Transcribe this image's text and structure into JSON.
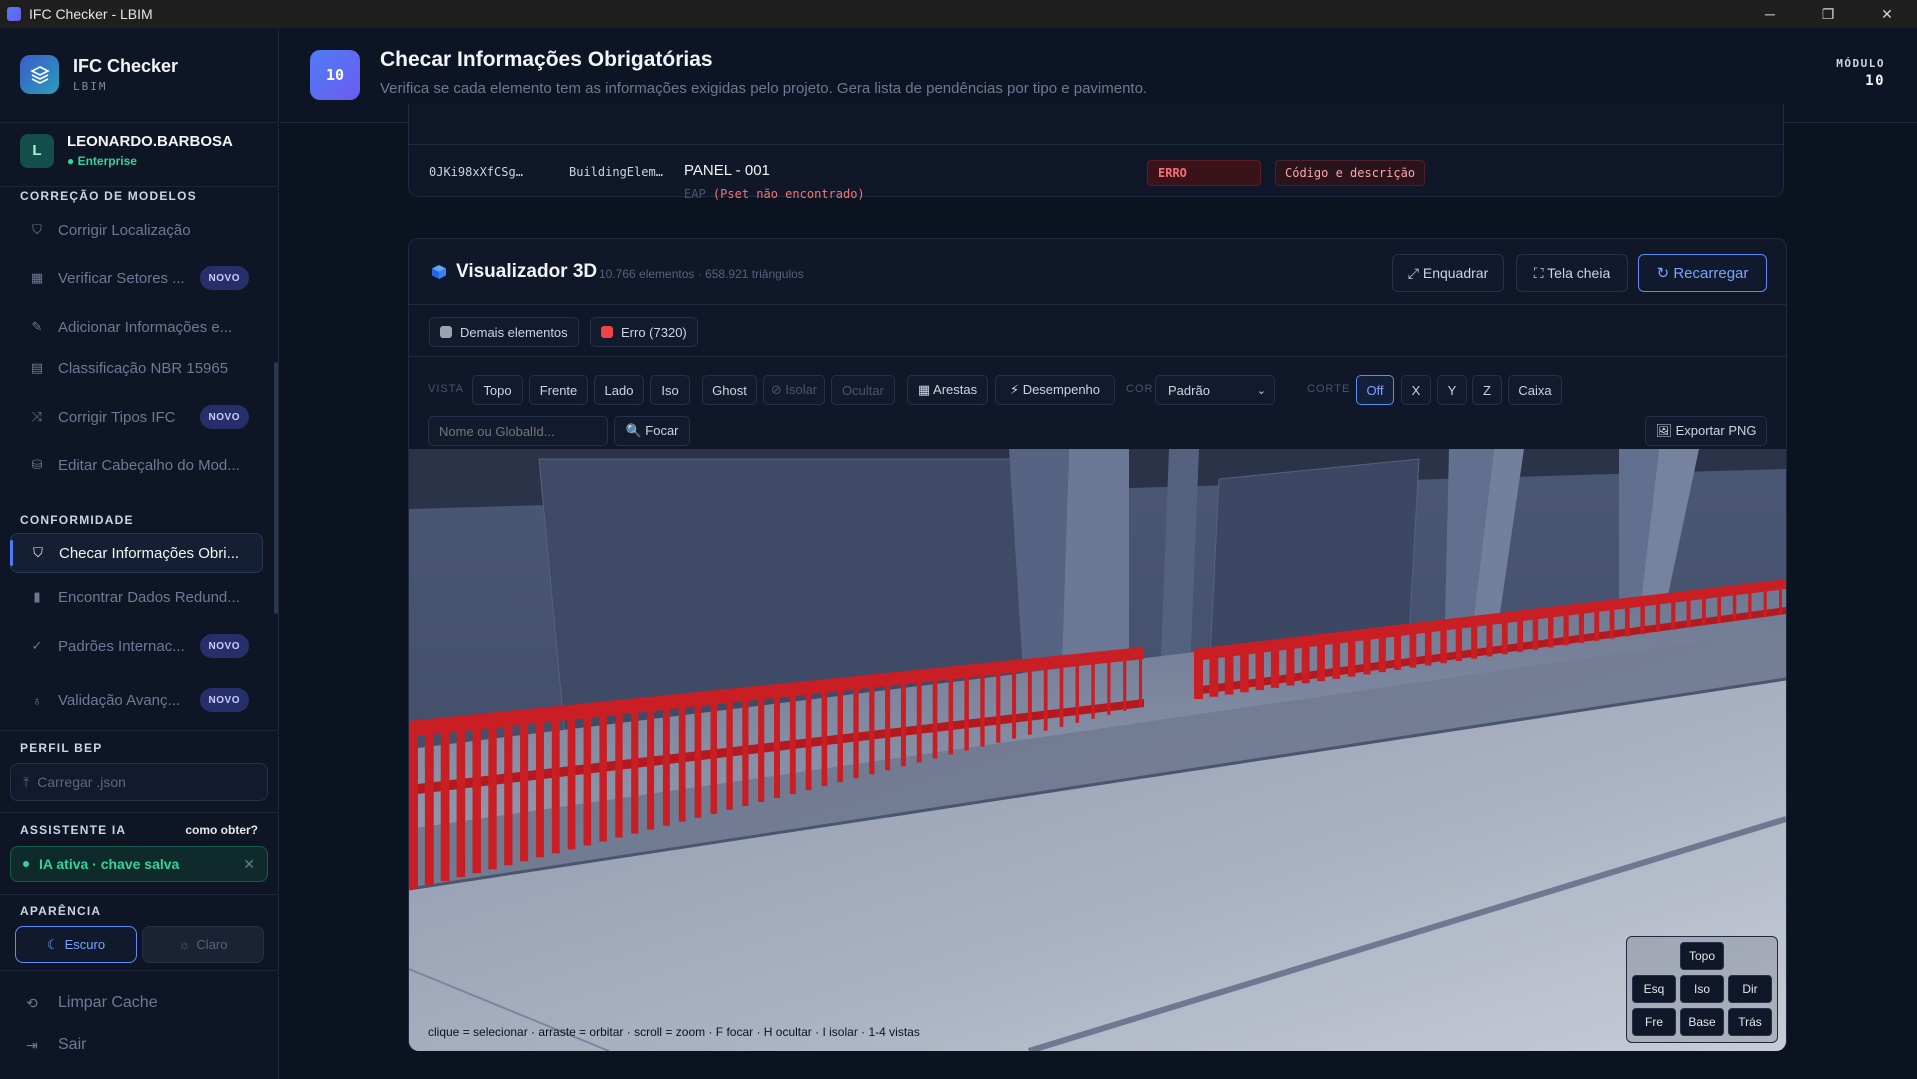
{
  "window": {
    "title": "IFC Checker - LBIM",
    "minimize": "─",
    "maximize": "❐",
    "close": "✕"
  },
  "sidebar": {
    "brand_name": "IFC Checker",
    "brand_sub": "LBIM",
    "user_initial": "L",
    "user_name": "LEONARDO.BARBOSA",
    "user_plan": "● Enterprise",
    "section_correcao": "CORREÇÃO DE MODELOS",
    "items_correcao": [
      {
        "label": "Corrigir Localização",
        "badge": ""
      },
      {
        "label": "Verificar Setores ...",
        "badge": "NOVO"
      },
      {
        "label": "Adicionar Informações e...",
        "badge": ""
      },
      {
        "label": "Classificação NBR 15965",
        "badge": ""
      },
      {
        "label": "Corrigir Tipos IFC",
        "badge": "NOVO"
      },
      {
        "label": "Editar Cabeçalho do Mod...",
        "badge": ""
      }
    ],
    "section_conformidade": "CONFORMIDADE",
    "items_conformidade": [
      {
        "label": "Checar Informações Obri...",
        "badge": ""
      },
      {
        "label": "Encontrar Dados Redund...",
        "badge": ""
      },
      {
        "label": "Padrões Internac...",
        "badge": "NOVO"
      },
      {
        "label": "Validação Avanç...",
        "badge": "NOVO"
      }
    ],
    "section_perfil": "PERFIL BEP",
    "file_input_label": "Carregar .json",
    "section_ia": "ASSISTENTE IA",
    "ia_help": "como obter?",
    "ia_status": "IA ativa · chave salva",
    "section_aparencia": "APARÊNCIA",
    "theme_dark": "Escuro",
    "theme_light": "Claro",
    "clear_cache": "Limpar Cache",
    "logout": "Sair"
  },
  "header": {
    "module_badge": "10",
    "title": "Checar Informações Obrigatórias",
    "description": "Verifica se cada elemento tem as informações exigidas pelo projeto. Gera lista de pendências por tipo e pavimento.",
    "module_label": "MÓDULO",
    "module_number": "10"
  },
  "result_row": {
    "guid": "0JKi98xXfCSg…",
    "ifc_class": "BuildingElem…",
    "name": "PANEL - 001",
    "detail_prefix": "EAP",
    "detail": "(Pset não encontrado)",
    "status": "ERRO",
    "issue": "Código e descrição"
  },
  "viewer": {
    "title": "Visualizador 3D",
    "stats": "10.766 elementos · 658.921 triângulos",
    "btn_fit": "⤢ Enquadrar",
    "btn_fullscreen": "⛶ Tela cheia",
    "btn_reload": "↻ Recarregar",
    "legend": [
      {
        "label": "Demais elementos",
        "color": "#9ca3af"
      },
      {
        "label": "Erro (7320)",
        "color": "#ef4444"
      }
    ],
    "label_vista": "VISTA",
    "views": [
      "Topo",
      "Frente",
      "Lado",
      "Iso"
    ],
    "btn_ghost": "Ghost",
    "btn_isolar": "⊘ Isolar",
    "btn_ocultar": "Ocultar",
    "btn_arestas": "▦ Arestas",
    "btn_desempenho": "⚡ Desempenho",
    "label_cor": "COR",
    "color_select": "Padrão",
    "label_corte": "CORTE",
    "cut_options": [
      "Off",
      "X",
      "Y",
      "Z",
      "Caixa"
    ],
    "search_placeholder": "Nome ou GlobalId...",
    "btn_focar": "🔍 Focar",
    "btn_export": "🖼 Exportar PNG",
    "hint": "clique = selecionar · arraste = orbitar · scroll = zoom · F focar · H ocultar · I isolar · 1-4 vistas",
    "nav_cube": {
      "top": "Topo",
      "left": "Esq",
      "iso": "Iso",
      "right": "Dir",
      "front": "Fre",
      "base": "Base",
      "back": "Trás"
    }
  }
}
